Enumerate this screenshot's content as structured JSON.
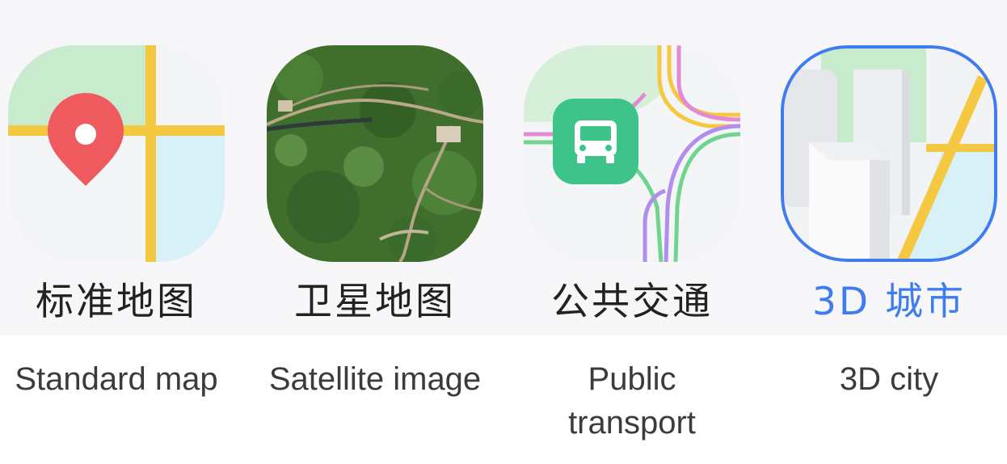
{
  "map_types": [
    {
      "key": "standard",
      "label_cn": "标准地图",
      "label_en": "Standard map",
      "icon": "map-pin-icon",
      "selected": false
    },
    {
      "key": "satellite",
      "label_cn": "卫星地图",
      "label_en": "Satellite image",
      "icon": "satellite-image-icon",
      "selected": false
    },
    {
      "key": "transit",
      "label_cn": "公共交通",
      "label_en": "Public transport",
      "icon": "bus-icon",
      "selected": false
    },
    {
      "key": "city3d",
      "label_cn": "3D 城市",
      "label_en": "3D city",
      "icon": "buildings-3d-icon",
      "selected": true
    }
  ],
  "colors": {
    "accent": "#3f7cf0",
    "road_yellow": "#f5c842",
    "pin_red": "#ef5a5f",
    "park_green": "#c9ebcd",
    "water_blue": "#d8f0f8",
    "bus_green": "#3ec48a",
    "label_text": "#222222",
    "caption_text": "#3b3b3b"
  }
}
